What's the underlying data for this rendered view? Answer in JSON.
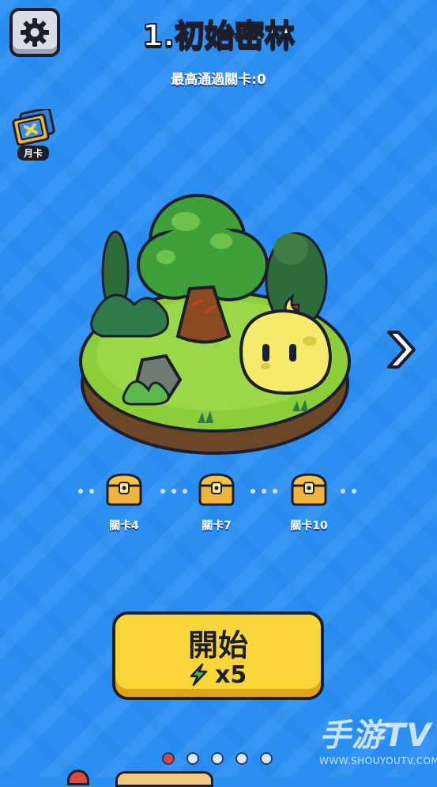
{
  "header": {
    "title": "1.初始密林",
    "best_cleared": "最高通過關卡:0"
  },
  "monthly_card": {
    "label": "月卡",
    "icon": "monthly-card-icon"
  },
  "settings": {
    "icon": "gear-icon"
  },
  "stage": {
    "icon": "forest-island-illustration"
  },
  "rewards": [
    {
      "label": "關卡4",
      "icon": "locked-chest-icon"
    },
    {
      "label": "關卡7",
      "icon": "locked-chest-icon"
    },
    {
      "label": "關卡10",
      "icon": "locked-chest-icon"
    }
  ],
  "start_button": {
    "label": "開始",
    "cost": "x5",
    "cost_icon": "energy-bolt-icon"
  },
  "pager": {
    "count": 5,
    "active_index": 0
  },
  "watermark": {
    "main": "手游TV",
    "url": "WWW.SHOUYOUTV.COM"
  },
  "colors": {
    "background": "#2b8ff2",
    "button": "#f8d63a",
    "outline": "#1c1f2b",
    "active_dot": "#e0463c"
  }
}
